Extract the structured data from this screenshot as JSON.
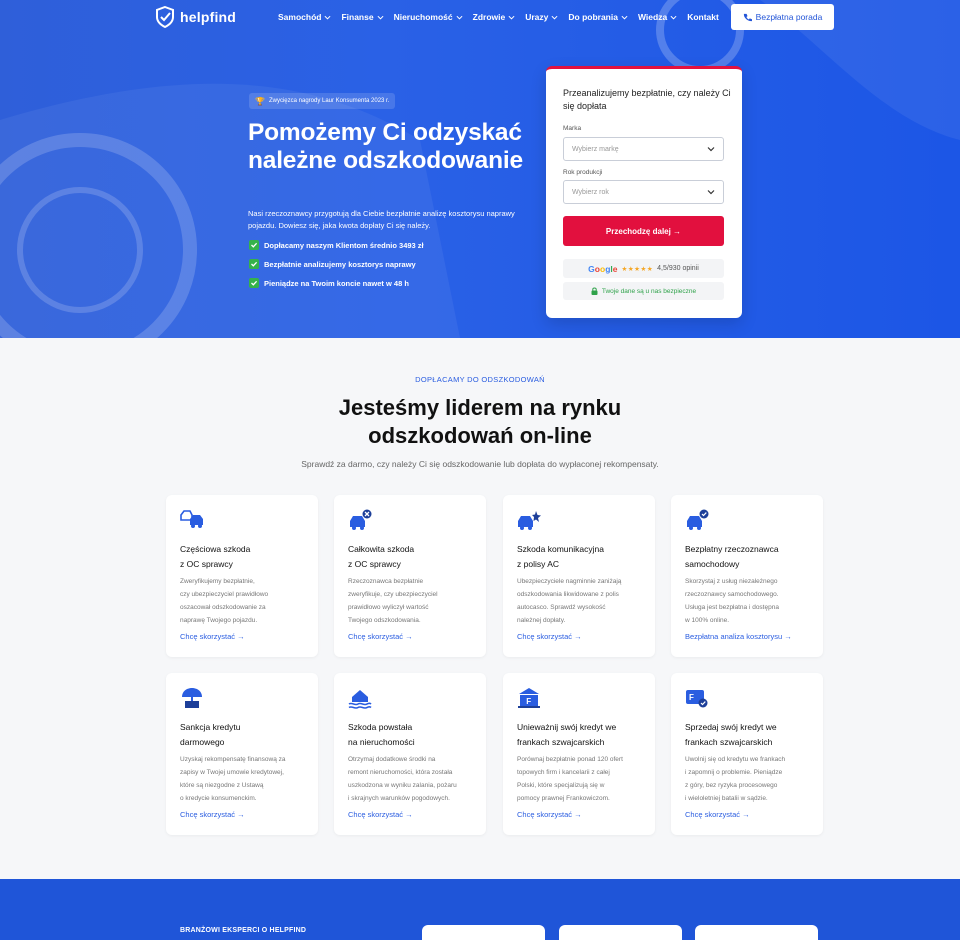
{
  "nav": {
    "logo": "helpfind",
    "items": [
      "Samochód",
      "Finanse",
      "Nieruchomość",
      "Zdrowie",
      "Urazy",
      "Do pobrania",
      "Wiedza",
      "Kontakt"
    ],
    "cta": "Bezpłatna porada"
  },
  "hero": {
    "award": "Zwycięzca nagrody Laur Konsumenta 2023 r.",
    "title": "Pomożemy Ci odzyskać należne odszkodowanie",
    "description": "Nasi rzeczoznawcy przygotują dla Ciebie bezpłatnie analizę kosztorysu naprawy pojazdu. Dowiesz się, jaka kwota dopłaty Ci się należy.",
    "checks": [
      "Dopłacamy naszym Klientom średnio 3493 zł",
      "Bezpłatnie analizujemy kosztorys naprawy",
      "Pieniądze na Twoim koncie nawet w 48 h"
    ]
  },
  "form": {
    "title": "Przeanalizujemy bezpłatnie, czy należy Ci się dopłata",
    "brand_label": "Marka",
    "brand_placeholder": "Wybierz markę",
    "year_label": "Rok produkcji",
    "year_placeholder": "Wybierz rok",
    "button": "Przechodzę dalej →",
    "google_word": "Google",
    "stars": "★★★★★",
    "rating": "4,5/930 opinii",
    "secure": "Twoje dane są u nas bezpieczne"
  },
  "section": {
    "eyebrow": "DOPŁACAMY DO ODSZKODOWAŃ",
    "title_line1": "Jesteśmy liderem na rynku",
    "title_line2": "odszkodowań on-line",
    "subtitle": "Sprawdź za darmo, czy należy Ci się odszkodowanie lub dopłata do wypłaconej rekompensaty."
  },
  "cards": [
    {
      "icon": "car-crash-icon",
      "title1": "Częściowa szkoda",
      "title2": "z OC sprawcy",
      "desc": [
        "Zweryfikujemy bezpłatnie,",
        "czy ubezpieczyciel prawidłowo",
        "oszacował odszkodowanie za",
        "naprawę Twojego pojazdu."
      ],
      "link": "Chcę skorzystać →"
    },
    {
      "icon": "car-total-loss-icon",
      "title1": "Całkowita szkoda",
      "title2": "z OC sprawcy",
      "desc": [
        "Rzeczoznawca bezpłatnie",
        "zweryfikuje, czy ubezpieczyciel",
        "prawidłowo wyliczył wartość",
        "Twojego odszkodowania."
      ],
      "link": "Chcę skorzystać →"
    },
    {
      "icon": "car-ac-icon",
      "title1": "Szkoda komunikacyjna",
      "title2": "z polisy AC",
      "desc": [
        "Ubezpieczyciele nagminnie zaniżają",
        "odszkodowania likwidowane z polis",
        "autocasco. Sprawdź wysokość",
        "należnej dopłaty."
      ],
      "link": "Chcę skorzystać →"
    },
    {
      "icon": "car-check-icon",
      "title1": "Bezpłatny rzeczoznawca",
      "title2": "samochodowy",
      "desc": [
        "Skorzystaj z usług niezależnego",
        "rzeczoznawcy samochodowego.",
        "Usługa jest bezpłatna i dostępna",
        "w 100% online."
      ],
      "link": "Bezpłatna analiza kosztorysu →"
    },
    {
      "icon": "umbrella-icon",
      "title1": "Sankcja kredytu",
      "title2": "darmowego",
      "desc": [
        "Uzyskaj rekompensatę finansową za",
        "zapisy w Twojej umowie kredytowej,",
        "które są niezgodne z Ustawą",
        "o kredycie konsumenckim."
      ],
      "link": "Chcę skorzystać →"
    },
    {
      "icon": "house-flood-icon",
      "title1": "Szkoda powstała",
      "title2": "na nieruchomości",
      "desc": [
        "Otrzymaj dodatkowe środki na",
        "remont nieruchomości, która została",
        "uszkodzona w wyniku zalania, pożaru",
        "i skrajnych warunków pogodowych."
      ],
      "link": "Chcę skorzystać →"
    },
    {
      "icon": "bank-franc-icon",
      "title1": "Unieważnij swój kredyt we",
      "title2": "frankach szwajcarskich",
      "desc": [
        "Porównaj bezpłatnie ponad 120 ofert",
        "topowych firm i kancelarii z całej",
        "Polski, które specjalizują się w",
        "pomocy prawnej Frankowiczom."
      ],
      "link": "Chcę skorzystać →"
    },
    {
      "icon": "franc-card-icon",
      "title1": "Sprzedaj swój kredyt we",
      "title2": "frankach szwajcarskich",
      "desc": [
        "Uwolnij się od kredytu we frankach",
        "i zapomnij o problemie. Pieniądze",
        "z góry, bez ryzyka procesowego",
        "i wieloletniej batalii w sądzie."
      ],
      "link": "Chcę skorzystać →"
    }
  ],
  "band": {
    "label": "BRANŻOWI EKSPERCI O HELPFIND"
  },
  "colors": {
    "brand_blue": "#2a5de0",
    "cta_red": "#e2103e",
    "success_green": "#2fa24a"
  }
}
